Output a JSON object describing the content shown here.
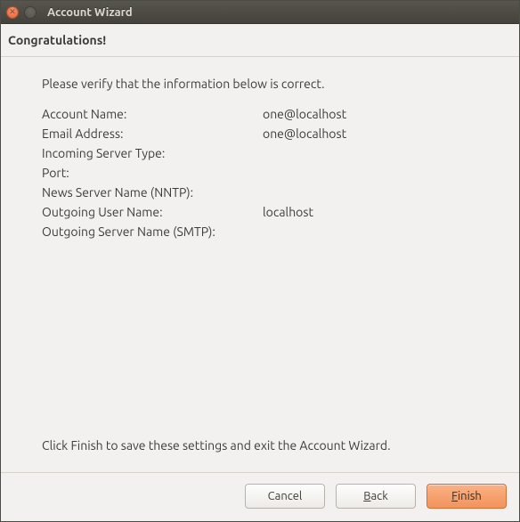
{
  "window": {
    "title": "Account Wizard"
  },
  "header": {
    "heading": "Congratulations!"
  },
  "content": {
    "intro": "Please verify that the information below is correct.",
    "outro": "Click Finish to save these settings and exit the Account Wizard.",
    "fields": [
      {
        "label": "Account Name:",
        "value": "one@localhost"
      },
      {
        "label": "Email Address:",
        "value": "one@localhost"
      },
      {
        "label": "Incoming Server Type:",
        "value": ""
      },
      {
        "label": "Port:",
        "value": ""
      },
      {
        "label": "News Server Name (NNTP):",
        "value": ""
      },
      {
        "label": "Outgoing User Name:",
        "value": "localhost"
      },
      {
        "label": "Outgoing Server Name (SMTP):",
        "value": ""
      }
    ]
  },
  "footer": {
    "cancel": "Cancel",
    "back_prefix": "",
    "back_underline": "B",
    "back_suffix": "ack",
    "finish_prefix": "",
    "finish_underline": "F",
    "finish_suffix": "inish"
  }
}
